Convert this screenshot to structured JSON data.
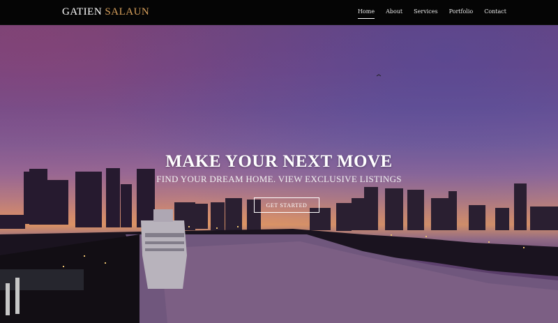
{
  "brand": {
    "first": "GATIEN",
    "last": "SALAUN",
    "accent_color": "#d9a15c"
  },
  "nav": {
    "items": [
      {
        "label": "Home",
        "active": true
      },
      {
        "label": "About",
        "active": false
      },
      {
        "label": "Services",
        "active": false
      },
      {
        "label": "Portfolio",
        "active": false
      },
      {
        "label": "Contact",
        "active": false
      }
    ]
  },
  "hero": {
    "title": "MAKE YOUR NEXT MOVE",
    "subtitle": "FIND YOUR DREAM HOME. VIEW EXCLUSIVE LISTINGS",
    "cta_label": "GET STARTED",
    "background": "city-sunset-harbor-image"
  }
}
